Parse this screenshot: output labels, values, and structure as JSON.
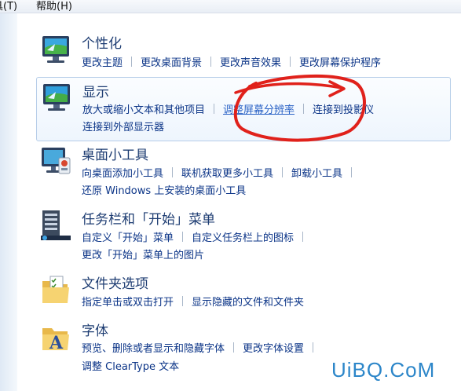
{
  "menu": [
    "具(T)",
    "帮助(H)"
  ],
  "sections": [
    {
      "title": "个性化",
      "icon": "personalization-monitor-icon",
      "lines": [
        [
          "更改主题",
          "更改桌面背景",
          "更改声音效果",
          "更改屏幕保护程序"
        ]
      ]
    },
    {
      "title": "显示",
      "icon": "display-monitor-icon",
      "lines": [
        [
          "放大或缩小文本和其他项目",
          "调整屏幕分辨率",
          "连接到投影仪"
        ],
        [
          "连接到外部显示器"
        ]
      ]
    },
    {
      "title": "桌面小工具",
      "icon": "desktop-gadgets-icon",
      "lines": [
        [
          "向桌面添加小工具",
          "联机获取更多小工具",
          "卸载小工具"
        ],
        [
          "还原 Windows 上安装的桌面小工具"
        ]
      ]
    },
    {
      "title": "任务栏和「开始」菜单",
      "icon": "taskbar-start-menu-icon",
      "lines": [
        [
          "自定义「开始」菜单",
          "自定义任务栏上的图标"
        ],
        [
          "更改「开始」菜单上的图片"
        ]
      ]
    },
    {
      "title": "文件夹选项",
      "icon": "folder-options-icon",
      "lines": [
        [
          "指定单击或双击打开",
          "显示隐藏的文件和文件夹"
        ]
      ]
    },
    {
      "title": "字体",
      "icon": "fonts-folder-icon",
      "lines": [
        [
          "预览、删除或者显示和隐藏字体",
          "更改字体设置"
        ],
        [
          "调整 ClearType 文本"
        ]
      ]
    }
  ],
  "watermark": "UiBQ.CoM"
}
